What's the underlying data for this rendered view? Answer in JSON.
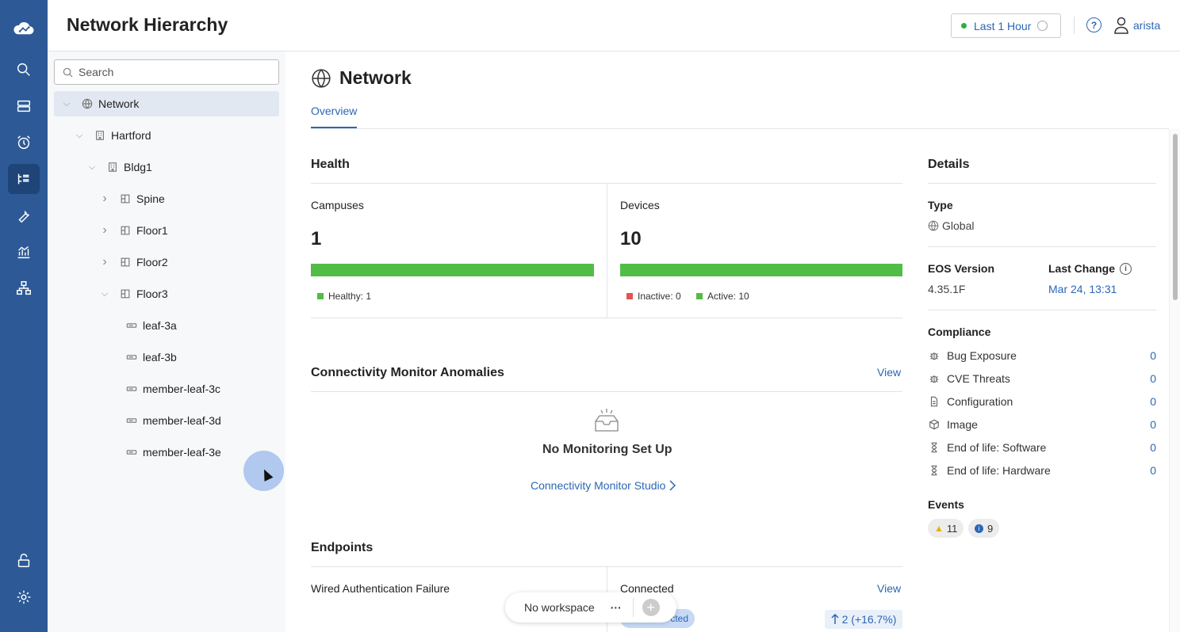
{
  "header": {
    "title": "Network Hierarchy",
    "time_range": "Last 1 Hour",
    "user": "arista"
  },
  "sidebar": {
    "search_placeholder": "Search",
    "tree": [
      {
        "label": "Network",
        "icon": "globe-icon",
        "depth": 0,
        "expanded": true,
        "selected": true
      },
      {
        "label": "Hartford",
        "icon": "building-icon",
        "depth": 1,
        "expanded": true
      },
      {
        "label": "Bldg1",
        "icon": "building-icon",
        "depth": 2,
        "expanded": true
      },
      {
        "label": "Spine",
        "icon": "floor-icon",
        "depth": 3,
        "expanded": false
      },
      {
        "label": "Floor1",
        "icon": "floor-icon",
        "depth": 3,
        "expanded": false
      },
      {
        "label": "Floor2",
        "icon": "floor-icon",
        "depth": 3,
        "expanded": false
      },
      {
        "label": "Floor3",
        "icon": "floor-icon",
        "depth": 3,
        "expanded": true
      },
      {
        "label": "leaf-3a",
        "icon": "device-icon",
        "depth": 4
      },
      {
        "label": "leaf-3b",
        "icon": "device-icon",
        "depth": 4
      },
      {
        "label": "member-leaf-3c",
        "icon": "device-icon",
        "depth": 4
      },
      {
        "label": "member-leaf-3d",
        "icon": "device-icon",
        "depth": 4
      },
      {
        "label": "member-leaf-3e",
        "icon": "device-icon",
        "depth": 4
      }
    ]
  },
  "main": {
    "title": "Network",
    "tab": "Overview",
    "health": {
      "title": "Health",
      "campuses": {
        "label": "Campuses",
        "value": "1",
        "legend": [
          {
            "label": "Healthy: 1",
            "color": "#51bd47"
          }
        ],
        "fill": 1.0
      },
      "devices": {
        "label": "Devices",
        "value": "10",
        "legend": [
          {
            "label": "Inactive: 0",
            "color": "#e55353"
          },
          {
            "label": "Active: 10",
            "color": "#51bd47"
          }
        ],
        "fill": 1.0
      }
    },
    "connectivity": {
      "title": "Connectivity Monitor Anomalies",
      "view": "View",
      "empty": "No Monitoring Set Up",
      "link": "Connectivity Monitor Studio"
    },
    "endpoints": {
      "title": "Endpoints",
      "left_label": "Wired Authentication Failure",
      "right_label": "Connected",
      "view": "View",
      "chip": "cted",
      "trend": "2 (+16.7%)"
    },
    "details": {
      "title": "Details",
      "type_label": "Type",
      "type_value": "Global",
      "eos_label": "EOS Version",
      "eos_value": "4.35.1F",
      "change_label": "Last Change",
      "change_value": "Mar 24, 13:31",
      "compliance_title": "Compliance",
      "compliance": [
        {
          "label": "Bug Exposure",
          "value": "0",
          "icon": "bug-icon"
        },
        {
          "label": "CVE Threats",
          "value": "0",
          "icon": "bug-icon"
        },
        {
          "label": "Configuration",
          "value": "0",
          "icon": "file-icon"
        },
        {
          "label": "Image",
          "value": "0",
          "icon": "cube-icon"
        },
        {
          "label": "End of life: Software",
          "value": "0",
          "icon": "hourglass-icon"
        },
        {
          "label": "End of life: Hardware",
          "value": "0",
          "icon": "hourglass-icon"
        }
      ],
      "events_title": "Events",
      "events_warning": "11",
      "events_info": "9"
    }
  },
  "workspace": {
    "label": "No workspace",
    "more": "···"
  },
  "colors": {
    "rail": "#2d5a96",
    "accent": "#2d66b5",
    "healthy": "#51bd47",
    "inactive": "#e55353"
  }
}
